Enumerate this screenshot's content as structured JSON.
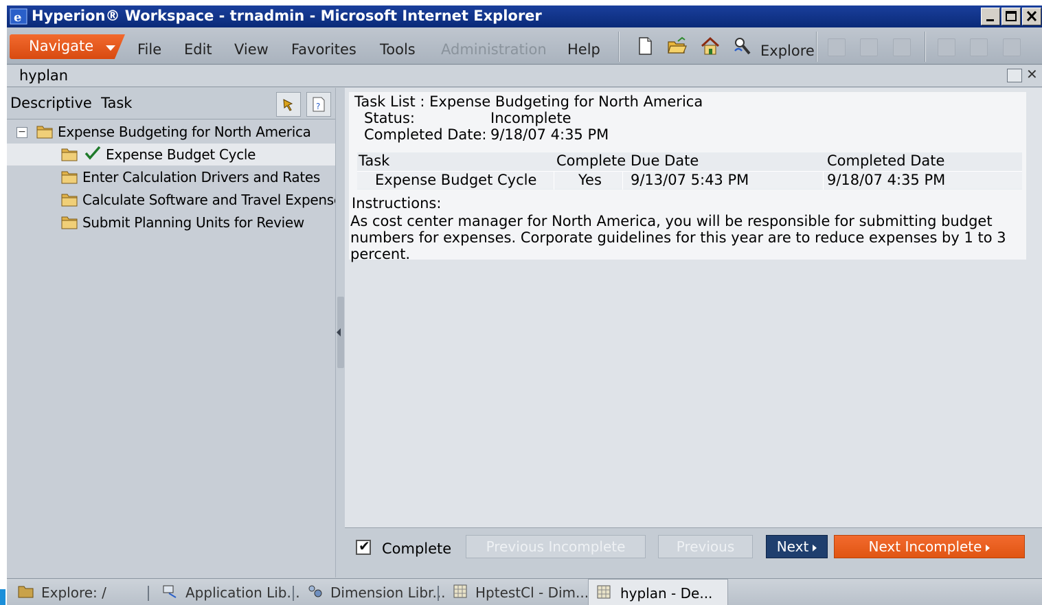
{
  "window": {
    "title": "Hyperion® Workspace - trnadmin - Microsoft Internet Explorer"
  },
  "menu": {
    "navigate": "Navigate",
    "items": [
      "File",
      "Edit",
      "View",
      "Favorites",
      "Tools",
      "Administration",
      "Help"
    ],
    "explore": "Explore"
  },
  "module": {
    "title": "hyplan"
  },
  "left_panel": {
    "header": "Descriptive  Task",
    "tree": [
      {
        "label": "Expense Budgeting for North America",
        "completed": false
      },
      {
        "label": "Expense Budget Cycle",
        "completed": true
      },
      {
        "label": "Enter Calculation Drivers and Rates",
        "completed": false
      },
      {
        "label": "Calculate Software and Travel Expenses",
        "completed": false
      },
      {
        "label": "Submit Planning Units for Review",
        "completed": false
      }
    ]
  },
  "task": {
    "title": "Task List : Expense Budgeting for North America",
    "status_label": "Status:",
    "status_value": "Incomplete",
    "completed_date_label": "Completed Date:",
    "completed_date_value": "9/18/07 4:35 PM",
    "table": {
      "headers": [
        "Task",
        "Complete",
        "Due Date",
        "Completed Date"
      ],
      "rows": [
        [
          "Expense Budget Cycle",
          "Yes",
          "9/13/07 5:43 PM",
          "9/18/07 4:35 PM"
        ]
      ]
    },
    "instructions_label": "Instructions:",
    "instructions_text": "As cost center manager for North America, you will be responsible for submitting budget numbers for expenses. Corporate guidelines for this year are to reduce expenses by 1 to 3 percent."
  },
  "actions": {
    "complete_label": "Complete",
    "complete_checked": true,
    "previous_incomplete": "Previous Incomplete",
    "previous": "Previous",
    "next": "Next",
    "next_incomplete": "Next Incomplete"
  },
  "taskbar": {
    "items": [
      "Explore: /",
      "Application Lib...",
      "Dimension Libr...",
      "HptestCl - Dim...",
      "hyplan - De..."
    ]
  },
  "colors": {
    "accent_orange": "#e05512",
    "title_blue": "#0a2a78",
    "next_blue": "#1f3f6e"
  }
}
